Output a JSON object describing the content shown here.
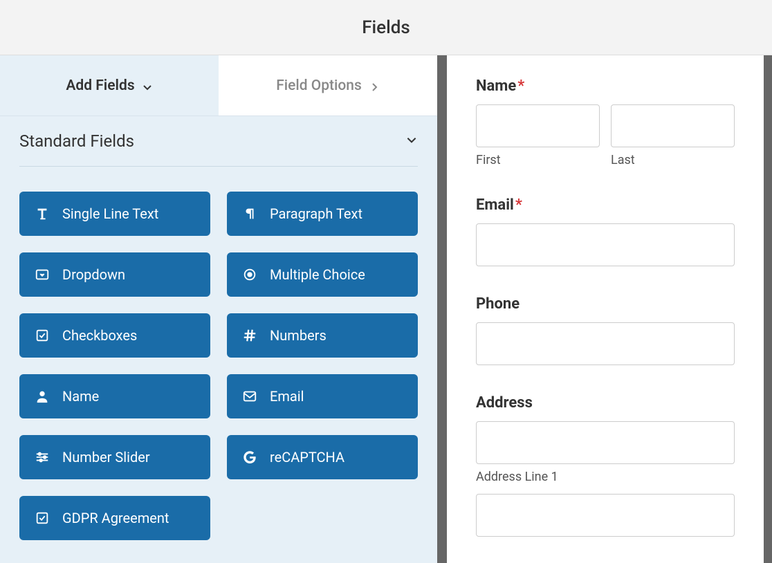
{
  "header": {
    "title": "Fields"
  },
  "tabs": {
    "add_fields": "Add Fields",
    "field_options": "Field Options"
  },
  "section": {
    "title": "Standard Fields"
  },
  "fields": [
    {
      "label": "Single Line Text",
      "icon": "text-icon"
    },
    {
      "label": "Paragraph Text",
      "icon": "paragraph-icon"
    },
    {
      "label": "Dropdown",
      "icon": "dropdown-icon"
    },
    {
      "label": "Multiple Choice",
      "icon": "radio-icon"
    },
    {
      "label": "Checkboxes",
      "icon": "checkbox-icon"
    },
    {
      "label": "Numbers",
      "icon": "hash-icon"
    },
    {
      "label": "Name",
      "icon": "user-icon"
    },
    {
      "label": "Email",
      "icon": "envelope-icon"
    },
    {
      "label": "Number Slider",
      "icon": "slider-icon"
    },
    {
      "label": "reCAPTCHA",
      "icon": "google-icon"
    },
    {
      "label": "GDPR Agreement",
      "icon": "checkbox-icon"
    }
  ],
  "preview": {
    "name_label": "Name",
    "first_sublabel": "First",
    "last_sublabel": "Last",
    "email_label": "Email",
    "phone_label": "Phone",
    "address_label": "Address",
    "address_line1_sublabel": "Address Line 1"
  }
}
